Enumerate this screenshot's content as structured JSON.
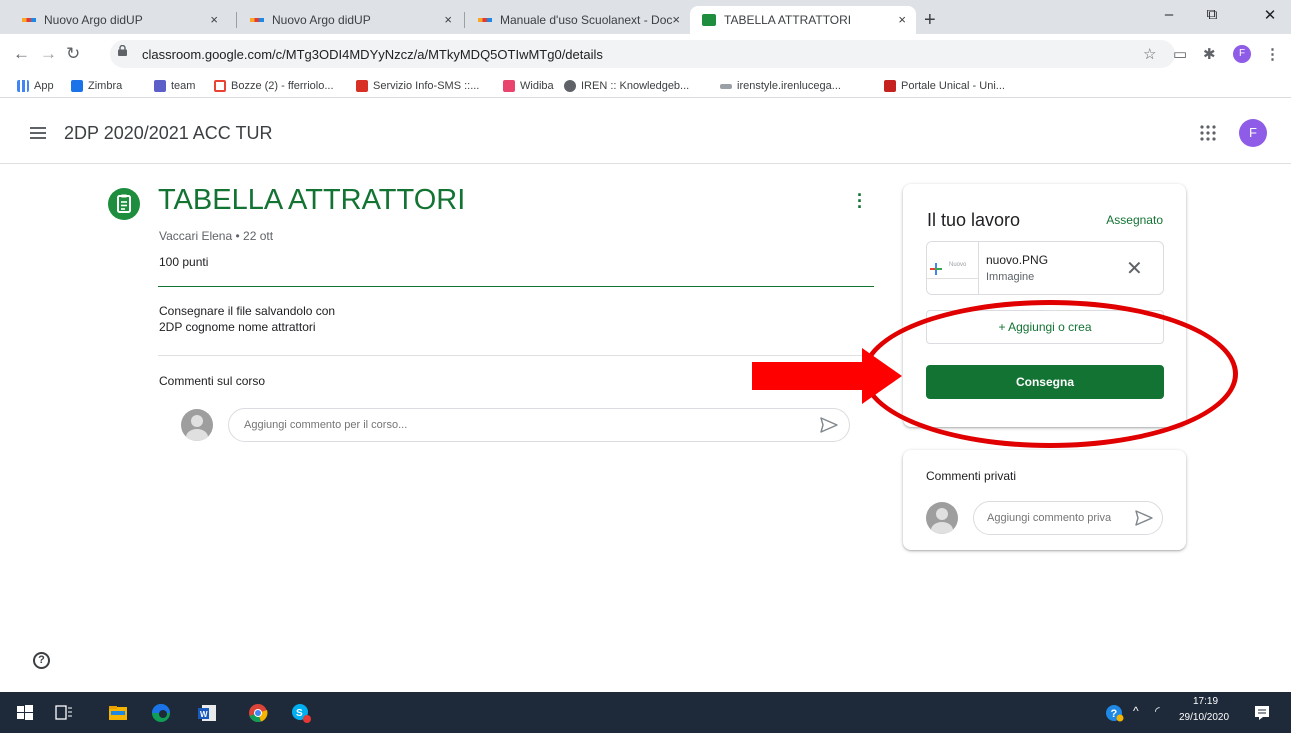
{
  "browser": {
    "tabs": [
      {
        "title": "Nuovo Argo didUP",
        "favicon": "argo-icon",
        "active": false
      },
      {
        "title": "Nuovo Argo didUP",
        "favicon": "argo-icon",
        "active": false
      },
      {
        "title": "Manuale d'uso Scuolanext - Doc",
        "favicon": "argo-icon",
        "active": false
      },
      {
        "title": "TABELLA ATTRATTORI",
        "favicon": "classroom-icon",
        "active": true
      }
    ],
    "tab_close_symbol": "×",
    "new_tab_symbol": "+",
    "window_controls": {
      "minimize": "–",
      "restore": "⧉",
      "close": "✕"
    },
    "nav": {
      "back": "←",
      "forward": "→",
      "reload": "↻"
    },
    "url": "classroom.google.com/c/MTg3ODI4MDYyNzcz/a/MTkyMDQ5OTIwMTg0/details",
    "profile_letter": "F",
    "bookmarks": [
      {
        "label": "App",
        "icon": "apps-grid-icon",
        "color": "#4285f4"
      },
      {
        "label": "Zimbra",
        "icon": "zimbra-icon",
        "color": "#1a73e8"
      },
      {
        "label": "team",
        "icon": "teams-icon",
        "color": "#5b5fc7"
      },
      {
        "label": "Bozze (2) - fferriolo...",
        "icon": "gmail-icon",
        "color": "#ea4335"
      },
      {
        "label": "Servizio Info-SMS ::...",
        "icon": "info-sms-icon",
        "color": "#d93025"
      },
      {
        "label": "Widiba",
        "icon": "widiba-icon",
        "color": "#e8446e"
      },
      {
        "label": "IREN :: Knowledgeb...",
        "icon": "globe-icon",
        "color": "#5f6368"
      },
      {
        "label": "irenstyle.irenlucega...",
        "icon": "iren-icon",
        "color": "#9aa0a6"
      },
      {
        "label": "Portale Unical - Uni...",
        "icon": "unical-icon",
        "color": "#c5221f"
      }
    ]
  },
  "header": {
    "class_title": "2DP 2020/2021 ACC TUR",
    "avatar_letter": "F"
  },
  "assignment": {
    "title": "TABELLA ATTRATTORI",
    "author_date": "Vaccari Elena • 22 ott",
    "points": "100 punti",
    "instructions_line1": "Consegnare il file salvandolo con",
    "instructions_line2": "2DP  cognome nome attrattori",
    "class_comments_heading": "Commenti sul corso",
    "class_comment_placeholder": "Aggiungi commento per il corso..."
  },
  "your_work": {
    "title": "Il tuo lavoro",
    "status": "Assegnato",
    "attachment": {
      "name": "nuovo.PNG",
      "type": "Immagine",
      "thumbnail_text": "Nuovo"
    },
    "remove_symbol": "✕",
    "add_label": "+  Aggiungi o crea",
    "submit_label": "Consegna"
  },
  "private_comments": {
    "title": "Commenti privati",
    "placeholder": "Aggiungi commento priva"
  },
  "help_symbol": "?",
  "taskbar": {
    "time": "17:19",
    "date": "29/10/2020"
  },
  "colors": {
    "classroom_green": "#137333",
    "annotation_red": "#e00000",
    "avatar_purple": "#8e5ce6"
  }
}
